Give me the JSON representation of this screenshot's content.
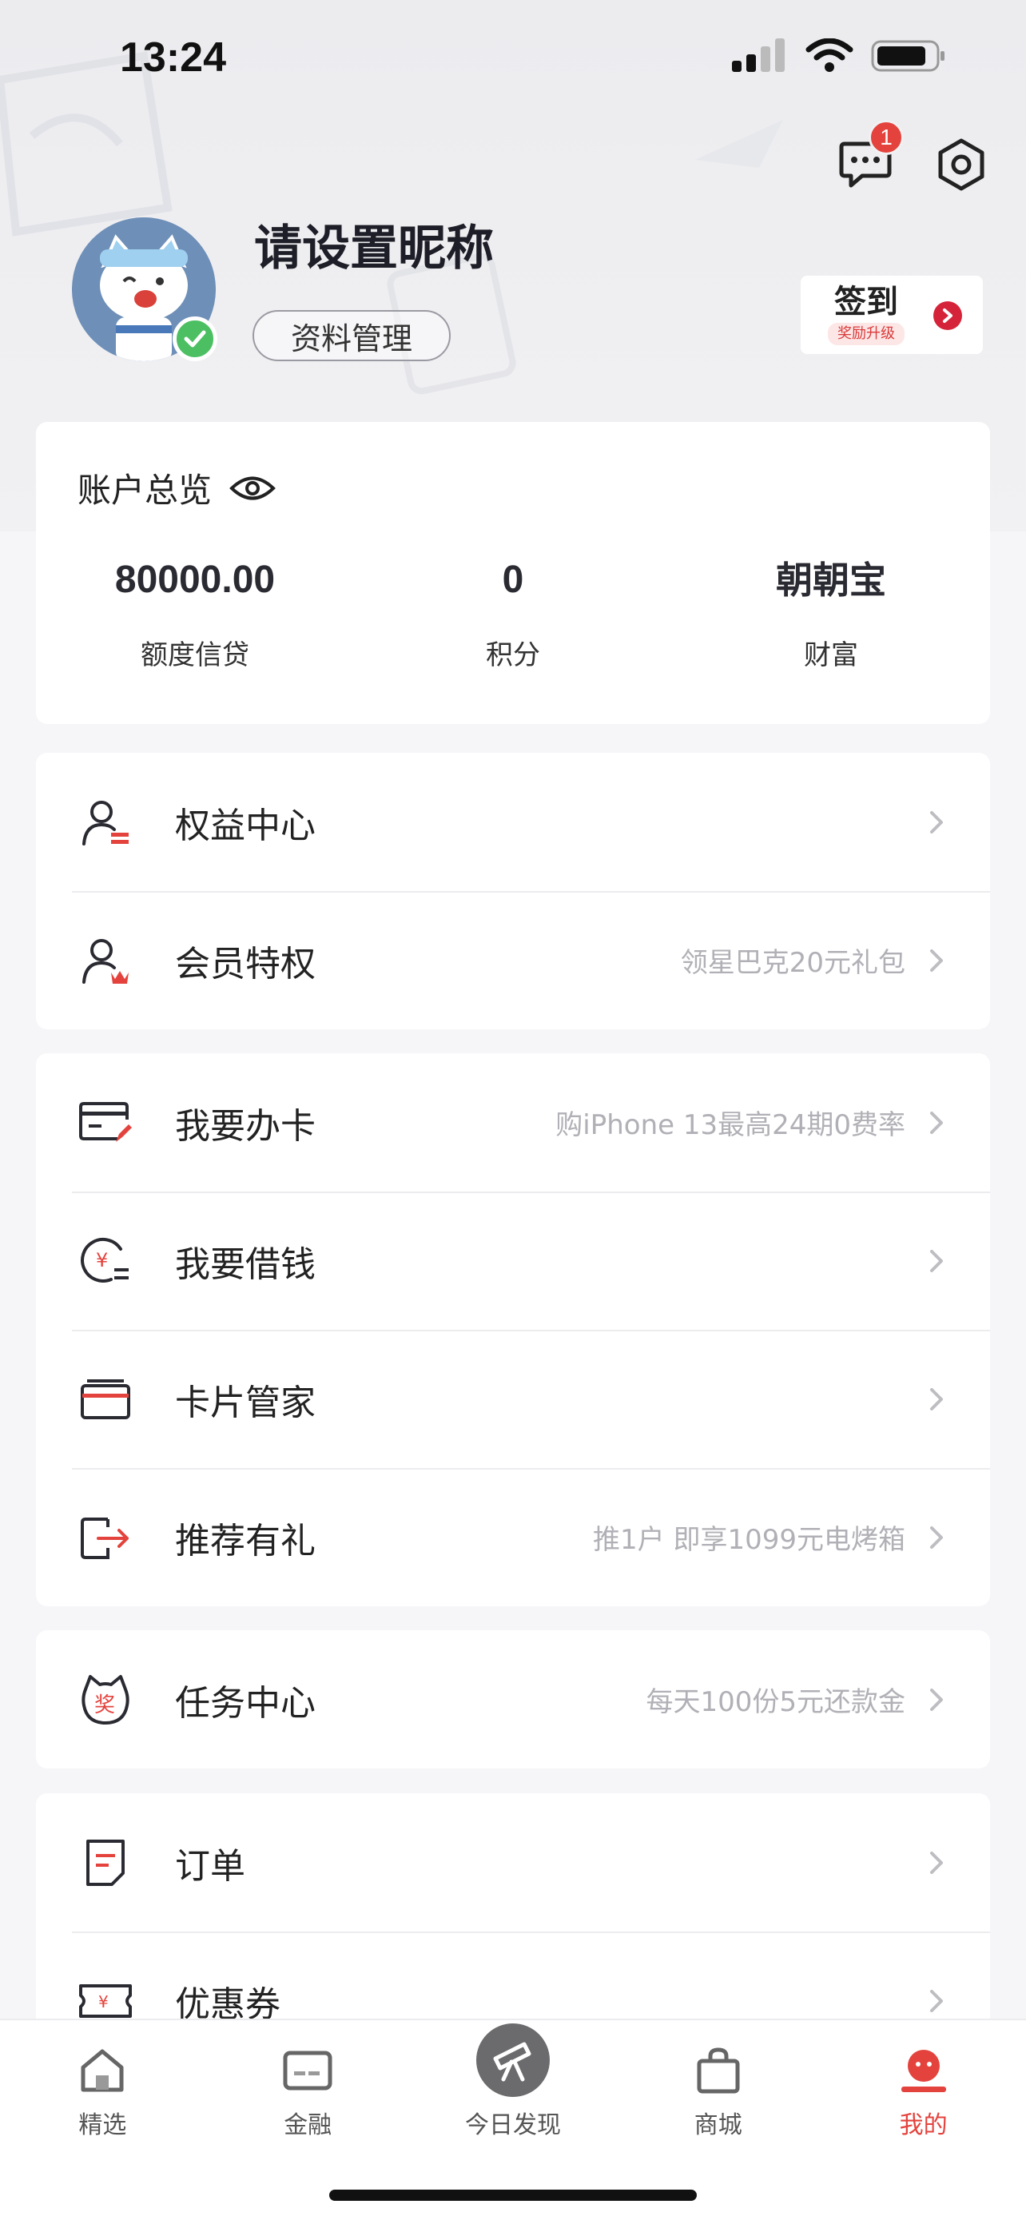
{
  "status_bar": {
    "time": "13:24"
  },
  "header": {
    "message_badge": "1",
    "nickname": "请设置昵称",
    "profile_button": "资料管理",
    "checkin": {
      "title": "签到",
      "subtitle": "奖励升级"
    }
  },
  "overview": {
    "title": "账户总览",
    "stats": [
      {
        "value": "80000.00",
        "label": "额度信贷"
      },
      {
        "value": "0",
        "label": "积分"
      },
      {
        "value": "朝朝宝",
        "label": "财富"
      }
    ]
  },
  "groups": [
    {
      "items": [
        {
          "label": "权益中心",
          "hint": "",
          "icon": "person-card-icon"
        },
        {
          "label": "会员特权",
          "hint": "领星巴克20元礼包",
          "icon": "person-crown-icon"
        }
      ]
    },
    {
      "items": [
        {
          "label": "我要办卡",
          "hint": "购iPhone 13最高24期0费率",
          "icon": "card-edit-icon"
        },
        {
          "label": "我要借钱",
          "hint": "",
          "icon": "yuan-loan-icon"
        },
        {
          "label": "卡片管家",
          "hint": "",
          "icon": "card-wallet-icon"
        },
        {
          "label": "推荐有礼",
          "hint": "推1户 即享1099元电烤箱",
          "icon": "share-exit-icon"
        }
      ]
    },
    {
      "items": [
        {
          "label": "任务中心",
          "hint": "每天100份5元还款金",
          "icon": "reward-cat-icon"
        }
      ]
    },
    {
      "items": [
        {
          "label": "订单",
          "hint": "",
          "icon": "order-icon"
        },
        {
          "label": "优惠券",
          "hint": "",
          "icon": "coupon-icon"
        }
      ]
    }
  ],
  "tabbar": [
    {
      "label": "精选",
      "icon": "home-icon"
    },
    {
      "label": "金融",
      "icon": "finance-card-icon"
    },
    {
      "label": "今日发现",
      "icon": "telescope-icon"
    },
    {
      "label": "商城",
      "icon": "shopping-bag-icon"
    },
    {
      "label": "我的",
      "icon": "profile-face-icon",
      "active": true
    }
  ],
  "colors": {
    "accent": "#e4433d",
    "checkin_arrow": "#d5243a",
    "verified": "#4bbf62"
  }
}
